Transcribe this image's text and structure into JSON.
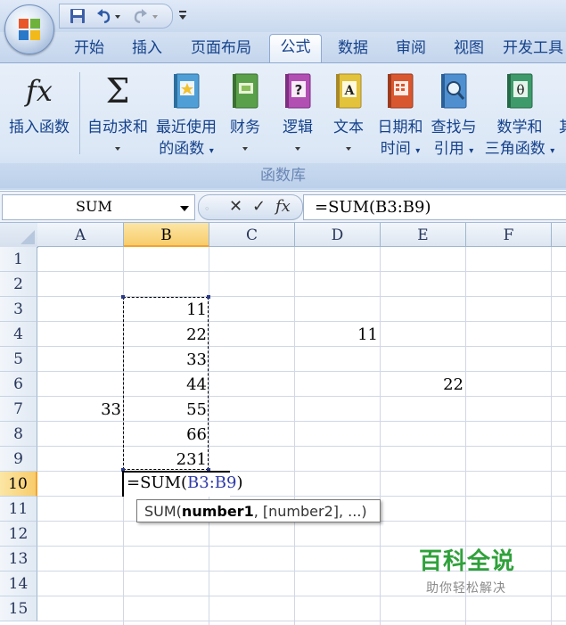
{
  "qat": {
    "customize_glyph": "₹"
  },
  "tabs": [
    "开始",
    "插入",
    "页面布局",
    "公式",
    "数据",
    "审阅",
    "视图",
    "开发工具"
  ],
  "active_tab": "公式",
  "ribbon": {
    "buttons": [
      {
        "label_line1": "插入函数",
        "label_line2": "",
        "icon": "fx-icon",
        "has_arrow": false
      },
      {
        "label_line1": "自动求和",
        "label_line2": "",
        "icon": "sigma-icon",
        "has_arrow": true
      },
      {
        "label_line1": "最近使用",
        "label_line2": "的函数",
        "icon": "recent-functions-book-icon",
        "has_arrow": true
      },
      {
        "label_line1": "财务",
        "label_line2": "",
        "icon": "financial-book-icon",
        "has_arrow": true
      },
      {
        "label_line1": "逻辑",
        "label_line2": "",
        "icon": "logical-book-icon",
        "has_arrow": true
      },
      {
        "label_line1": "文本",
        "label_line2": "",
        "icon": "text-book-icon",
        "has_arrow": true
      },
      {
        "label_line1": "日期和",
        "label_line2": "时间",
        "icon": "date-time-book-icon",
        "has_arrow": true
      },
      {
        "label_line1": "查找与",
        "label_line2": "引用",
        "icon": "lookup-book-icon",
        "has_arrow": true
      },
      {
        "label_line1": "数学和",
        "label_line2": "三角函数",
        "icon": "math-trig-book-icon",
        "has_arrow": true
      },
      {
        "label_line1": "其",
        "label_line2": "",
        "icon": "more-functions-book-icon",
        "has_arrow": false
      }
    ],
    "group_label": "函数库",
    "icon_colors": {
      "recent": "#4f9fd6",
      "financial": "#5aa04a",
      "logical": "#b14fb3",
      "text": "#e3c23c",
      "datetime": "#d9572f",
      "lookup": "#4f8fd0",
      "math": "#3f9a6b"
    }
  },
  "formula_bar": {
    "name_box": "SUM",
    "cancel_glyph": "✕",
    "enter_glyph": "✓",
    "fx_glyph": "fx",
    "formula": "=SUM(B3:B9)"
  },
  "sheet": {
    "columns": [
      "A",
      "B",
      "C",
      "D",
      "E",
      "F"
    ],
    "selected_column": "B",
    "rows": [
      "1",
      "2",
      "3",
      "4",
      "5",
      "6",
      "7",
      "8",
      "9",
      "10",
      "11",
      "12",
      "13",
      "14",
      "15"
    ],
    "selected_row": "10",
    "cells": {
      "B3": "11",
      "B4": "22",
      "B5": "33",
      "B6": "44",
      "B7": "55",
      "B8": "66",
      "B9": "231",
      "D4": "11",
      "E6": "22",
      "A7": "33"
    },
    "edit_cell": {
      "prefix": "=SUM(",
      "ref": "B3:B9",
      "suffix": ")"
    },
    "tooltip": {
      "fn": "SUM(",
      "arg1": "number1",
      "rest": ", [number2], ...)"
    }
  },
  "watermark": {
    "title": "百科全说",
    "subtitle": "助你轻松解决"
  }
}
